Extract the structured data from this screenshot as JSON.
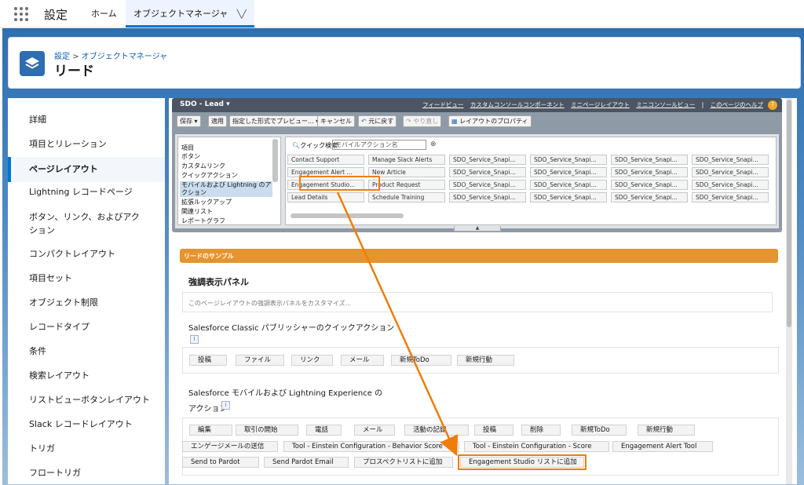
{
  "topbar": {
    "app_title": "設定",
    "tabs": [
      {
        "label": "ホーム"
      },
      {
        "label": "オブジェクトマネージャ"
      }
    ]
  },
  "header": {
    "breadcrumb_root": "設定",
    "breadcrumb_sep": ">",
    "breadcrumb_current": "オブジェクトマネージャ",
    "title": "リード"
  },
  "sidebar": {
    "items": [
      {
        "label": "詳細"
      },
      {
        "label": "項目とリレーション"
      },
      {
        "label": "ページレイアウト"
      },
      {
        "label": "Lightning レコードページ"
      },
      {
        "label": "ボタン、リンク、およびアクション"
      },
      {
        "label": "コンパクトレイアウト"
      },
      {
        "label": "項目セット"
      },
      {
        "label": "オブジェクト制限"
      },
      {
        "label": "レコードタイプ"
      },
      {
        "label": "条件"
      },
      {
        "label": "検索レイアウト"
      },
      {
        "label": "リストビューボタンレイアウト"
      },
      {
        "label": "Slack レコードレイアウト"
      },
      {
        "label": "トリガ"
      },
      {
        "label": "フロートリガ"
      }
    ]
  },
  "palette": {
    "title": "SDO - Lead ▾",
    "links": [
      "フィードビュー",
      "カスタムコンソールコンポーネント",
      "ミニページレイアウト",
      "ミニコンソールビュー",
      "|",
      "このページのヘルプ"
    ],
    "help": "?",
    "toolbar": {
      "save": "保存 ▾",
      "apply": "適用",
      "preview": "指定した形式でプレビュー... ▾",
      "cancel": "キャンセル",
      "undo": "元に戻す",
      "redo": "やり直し",
      "layout_props": "レイアウトのプロパティ"
    },
    "categories": [
      {
        "label": "項目"
      },
      {
        "label": "ボタン"
      },
      {
        "label": "カスタムリンク"
      },
      {
        "label": "クイックアクション"
      },
      {
        "label": "モバイルおよび Lightning のアクション"
      },
      {
        "label": "拡張ルックアップ"
      },
      {
        "label": "関連リスト"
      },
      {
        "label": "レポートグラフ"
      }
    ],
    "quick_find_label": "クイック検索",
    "quick_find_placeholder": "モバイルアクション名",
    "clear": "⊗",
    "grid": [
      [
        "Contact Support",
        "Manage Slack Alerts",
        "SDO_Service_Snapi...",
        "SDO_Service_Snapi...",
        "SDO_Service_Snapi...",
        "SDO_Service_Snapi..."
      ],
      [
        "Engagement Alert ...",
        "New Article",
        "SDO_Service_Snapi...",
        "SDO_Service_Snapi...",
        "SDO_Service_Snapi...",
        "SDO_Service_Snapi..."
      ],
      [
        "Engagement Studio...",
        "Product Request",
        "SDO_Service_Snapi...",
        "SDO_Service_Snapi...",
        "SDO_Service_Snapi...",
        "SDO_Service_Snapi..."
      ],
      [
        "Lead Details",
        "Schedule Training",
        "SDO_Service_Snapi...",
        "SDO_Service_Snapi...",
        "SDO_Service_Snapi...",
        "SDO_Service_Snapi..."
      ]
    ]
  },
  "layout": {
    "section_bar": "リードのサンプル",
    "highlights_title": "強調表示パネル",
    "highlights_hint": "このページレイアウトの強調表示パネルをカスタマイズ...",
    "classic_title": "Salesforce Classic パブリッシャーのクイックアクション",
    "info_glyph": "i",
    "classic_actions": [
      "投稿",
      "ファイル",
      "リンク",
      "メール",
      "新規ToDo",
      "新規行動"
    ],
    "mobile_title_1": "Salesforce モバイルおよび Lightning Experience の",
    "mobile_title_2": "アクション",
    "mobile_row1": [
      "編集",
      "取引の開始",
      "電話",
      "メール",
      "活動の記録",
      "投稿",
      "削除",
      "新規ToDo",
      "新規行動"
    ],
    "mobile_row2": [
      "エンゲージメールの送信",
      "Tool - Einstein Configuration - Behavior Score",
      "Tool - Einstein Configuration - Score",
      "Engagement Alert Tool"
    ],
    "mobile_row3": [
      "Send to Pardot",
      "Send Pardot Email",
      "プロスペクトリストに追加",
      "Engagement Studio リストに追加"
    ]
  },
  "colors": {
    "accent": "#0176d3",
    "highlight": "#f07d0a",
    "section_bar": "#e4952f",
    "palette_header": "#4b5563"
  }
}
